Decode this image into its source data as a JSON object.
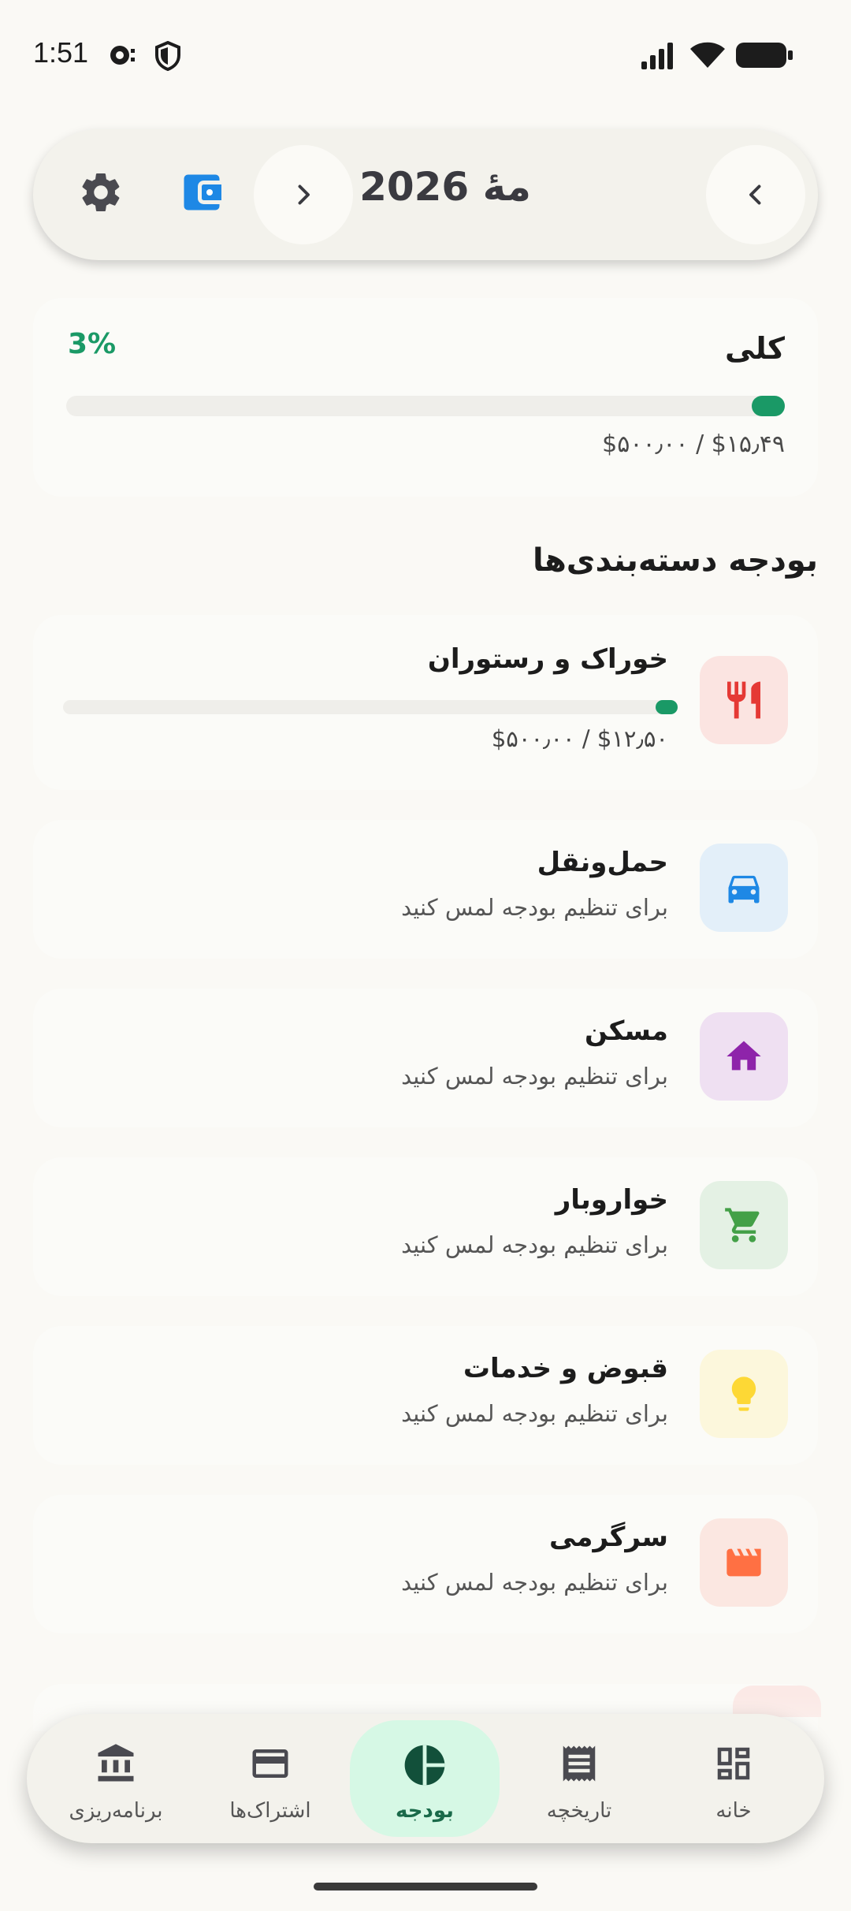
{
  "status_bar": {
    "time": "1:51"
  },
  "header": {
    "month_title": "مهٔ 2026"
  },
  "overall": {
    "label": "کلی",
    "percent": "3%",
    "amount": "$۱۵٫۴۹ / $۵۰۰٫۰۰",
    "progress": 0.03
  },
  "section_heading": "بودجه دسته‌بندی‌ها",
  "categories": [
    {
      "name": "خوراک و رستوران",
      "amount": "$۱۲٫۵۰ / $۵۰۰٫۰۰",
      "icon": "restaurant-icon",
      "color": "#e53935",
      "bg": "#fbe4e1"
    },
    {
      "name": "حمل‌ونقل",
      "subtitle": "برای تنظیم بودجه لمس کنید",
      "icon": "car-icon",
      "color": "#1e88e5",
      "bg": "#e3eff9"
    },
    {
      "name": "مسکن",
      "subtitle": "برای تنظیم بودجه لمس کنید",
      "icon": "home-icon",
      "color": "#8e24aa",
      "bg": "#efe0f2"
    },
    {
      "name": "خواروبار",
      "subtitle": "برای تنظیم بودجه لمس کنید",
      "icon": "cart-icon",
      "color": "#43a047",
      "bg": "#e4f1e4"
    },
    {
      "name": "قبوض و خدمات",
      "subtitle": "برای تنظیم بودجه لمس کنید",
      "icon": "lightbulb-icon",
      "color": "#fdd835",
      "bg": "#fcf7dc"
    },
    {
      "name": "سرگرمی",
      "subtitle": "برای تنظیم بودجه لمس کنید",
      "icon": "clapperboard-icon",
      "color": "#ff7043",
      "bg": "#fbe7e1"
    }
  ],
  "nav": {
    "items": [
      {
        "label": "برنامه‌ریزی",
        "icon": "bank-icon"
      },
      {
        "label": "اشتراک‌ها",
        "icon": "credit-card-icon"
      },
      {
        "label": "بودجه",
        "icon": "pie-chart-icon",
        "active": true
      },
      {
        "label": "تاریخچه",
        "icon": "receipt-icon"
      },
      {
        "label": "خانه",
        "icon": "dashboard-icon"
      }
    ]
  },
  "colors": {
    "accent": "#1a9966",
    "active_nav_bg": "#d6f8e5",
    "wallet": "#1e88e5"
  }
}
